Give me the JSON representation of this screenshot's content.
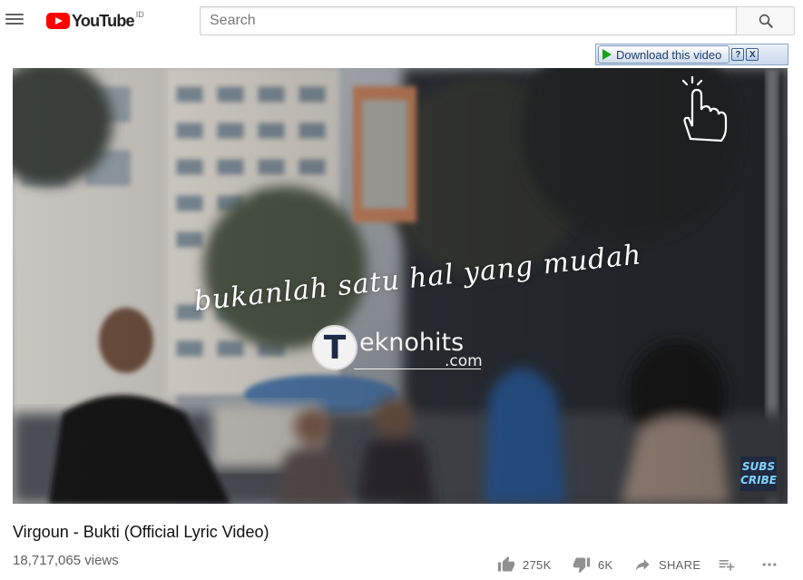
{
  "header": {
    "logo_text": "YouTube",
    "country_code": "ID",
    "search_placeholder": "Search"
  },
  "download_bar": {
    "button_label": "Download this video",
    "help_label": "?",
    "close_label": "X"
  },
  "player": {
    "lyric_text": "bukanlah satu hal yang mudah",
    "watermark_letter": "T",
    "watermark_text": "eknohits",
    "watermark_domain": ".com",
    "subscribe_line1": "SUBS",
    "subscribe_line2": "CRIBE"
  },
  "video": {
    "title": "Virgoun - Bukti (Official Lyric Video)",
    "views": "18,717,065 views"
  },
  "actions": {
    "likes": "275K",
    "dislikes": "6K",
    "share_label": "SHARE"
  },
  "colors": {
    "brand_red": "#ff0000",
    "download_arrow": "#1aa31a",
    "icon_gray": "#606060"
  },
  "icons": [
    "menu-icon",
    "youtube-logo-icon",
    "search-icon",
    "download-arrow-icon",
    "help-icon",
    "close-icon",
    "pointer-hand-icon",
    "like-icon",
    "dislike-icon",
    "share-icon",
    "add-to-playlist-icon",
    "more-icon"
  ]
}
